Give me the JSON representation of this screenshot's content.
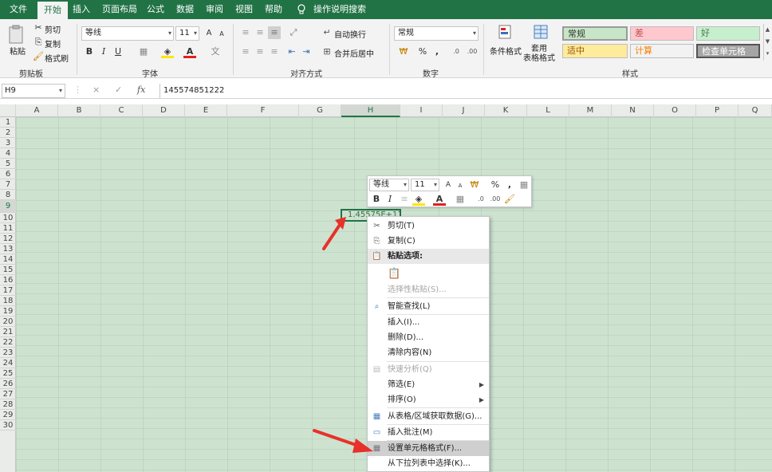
{
  "tabs": [
    {
      "label": "文件",
      "active": false
    },
    {
      "label": "开始",
      "active": true
    },
    {
      "label": "插入",
      "active": false
    },
    {
      "label": "页面布局",
      "active": false
    },
    {
      "label": "公式",
      "active": false
    },
    {
      "label": "数据",
      "active": false
    },
    {
      "label": "审阅",
      "active": false
    },
    {
      "label": "视图",
      "active": false
    },
    {
      "label": "帮助",
      "active": false
    }
  ],
  "search_label": "操作说明搜索",
  "ribbon": {
    "clipboard": {
      "paste": "粘贴",
      "cut": "剪切",
      "copy": "复制",
      "format_painter": "格式刷",
      "group": "剪贴板"
    },
    "font": {
      "name": "等线",
      "size": "11",
      "grow": "A",
      "shrink": "A",
      "bold": "B",
      "italic": "I",
      "underline": "U",
      "group": "字体"
    },
    "alignment": {
      "wrap": "自动换行",
      "merge": "合并后居中",
      "group": "对齐方式"
    },
    "number": {
      "format": "常规",
      "currency": "₩",
      "percent": "%",
      "comma": ",",
      "group": "数字"
    },
    "styles": {
      "conditional": "条件格式",
      "table_format": "套用\n表格格式",
      "group": "样式",
      "cells": [
        {
          "label": "常规",
          "bg": "#c7e6c7",
          "fg": "#333333"
        },
        {
          "label": "差",
          "bg": "#ffc7ce",
          "fg": "#c0504d"
        },
        {
          "label": "好",
          "bg": "#c6efce",
          "fg": "#4a7a4a"
        },
        {
          "label": "适中",
          "bg": "#ffeb9c",
          "fg": "#9c5700"
        },
        {
          "label": "计算",
          "bg": "#f2f2f2",
          "fg": "#fa7d00"
        },
        {
          "label": "检查单元格",
          "bg": "#a5a5a5",
          "fg": "#ffffff"
        }
      ]
    }
  },
  "formula_bar": {
    "cell_ref": "H9",
    "cancel": "×",
    "enter": "✓",
    "fx": "fx",
    "value": "145574851222"
  },
  "columns": [
    "A",
    "B",
    "C",
    "D",
    "E",
    "F",
    "G",
    "H",
    "I",
    "J",
    "K",
    "L",
    "M",
    "N",
    "O",
    "P",
    "Q"
  ],
  "selected_column": "H",
  "rows": [
    "1",
    "2",
    "3",
    "4",
    "5",
    "6",
    "7",
    "8",
    "9",
    "10",
    "11",
    "12",
    "13",
    "14",
    "15",
    "16",
    "17",
    "18",
    "19",
    "20",
    "21",
    "22",
    "23",
    "24",
    "25",
    "26",
    "27",
    "28",
    "29",
    "30"
  ],
  "selected_row": "9",
  "active_cell_text": "1.45575E+11",
  "mini_toolbar": {
    "font": "等线",
    "size": "11",
    "grow": "A",
    "shrink": "A",
    "percent": "%",
    "comma": ",",
    "bold": "B",
    "italic": "I",
    "font_color": "A"
  },
  "context_menu": [
    {
      "label": "剪切(T)",
      "icon": "scissors-icon",
      "disabled": false
    },
    {
      "label": "复制(C)",
      "icon": "copy-icon",
      "disabled": false
    },
    {
      "label": "粘贴选项:",
      "icon": "paste-icon",
      "header": true
    },
    {
      "label": "",
      "icon": "paste-option-icon",
      "disabled": true
    },
    {
      "label": "选择性粘贴(S)...",
      "icon": "",
      "disabled": true
    },
    {
      "label": "智能查找(L)",
      "icon": "smart-lookup-icon",
      "disabled": false
    },
    {
      "label": "插入(I)...",
      "icon": "",
      "disabled": false
    },
    {
      "label": "删除(D)...",
      "icon": "",
      "disabled": false
    },
    {
      "label": "清除内容(N)",
      "icon": "",
      "disabled": false
    },
    {
      "label": "快速分析(Q)",
      "icon": "quick-analysis-icon",
      "disabled": true
    },
    {
      "label": "筛选(E)",
      "icon": "",
      "disabled": false,
      "submenu": true
    },
    {
      "label": "排序(O)",
      "icon": "",
      "disabled": false,
      "submenu": true
    },
    {
      "label": "从表格/区域获取数据(G)...",
      "icon": "table-icon",
      "disabled": false
    },
    {
      "label": "插入批注(M)",
      "icon": "comment-icon",
      "disabled": false
    },
    {
      "label": "设置单元格格式(F)...",
      "icon": "format-cells-icon",
      "disabled": false,
      "highlight": true
    },
    {
      "label": "从下拉列表中选择(K)...",
      "icon": "",
      "disabled": false
    }
  ],
  "accent_colors": {
    "excel_green": "#217346",
    "sheet_bg": "#cde3d0",
    "arrow_red": "#e8312a"
  }
}
